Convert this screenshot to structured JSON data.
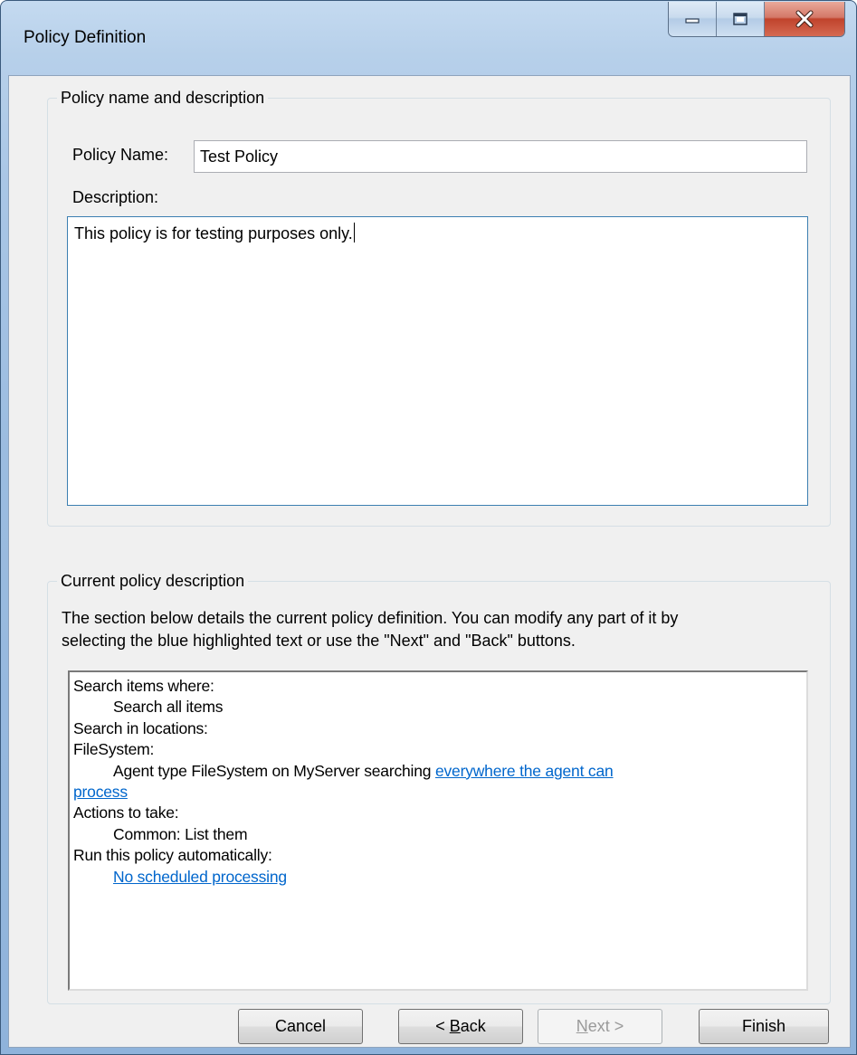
{
  "window": {
    "title": "Policy Definition"
  },
  "group_name": {
    "legend": "Policy name and description",
    "name_label": "Policy Name:",
    "name_value": "Test Policy",
    "description_label": "Description:",
    "description_value": "This policy is for testing purposes only."
  },
  "group_current": {
    "legend": "Current policy description",
    "intro_line1": "The section below details the current policy definition. You can modify any part of it by",
    "intro_line2": "selecting the blue highlighted text or use the \"Next\" and \"Back\" buttons.",
    "details": {
      "search_items_where": "Search items where:",
      "search_all_items": "Search all items",
      "search_in_locations": "Search in locations:",
      "filesystem": "FileSystem:",
      "agent_prefix": "Agent type FileSystem on MyServer searching ",
      "agent_link_part1": "everywhere the agent can",
      "agent_link_part2": "process",
      "actions_to_take": "Actions to take:",
      "common_action": "Common: List them",
      "run_automatically": "Run this policy automatically:",
      "schedule_link": "No scheduled processing"
    }
  },
  "buttons": {
    "cancel": "Cancel",
    "back_prefix": "< ",
    "back_accel": "B",
    "back_rest": "ack",
    "next_accel": "N",
    "next_rest": "ext >",
    "finish": "Finish"
  },
  "colors": {
    "link": "#0066cc",
    "disabled_text": "#9a9a9a",
    "close_button": "#c0432c"
  },
  "icons": [
    "minimize-icon",
    "maximize-icon",
    "close-icon"
  ]
}
